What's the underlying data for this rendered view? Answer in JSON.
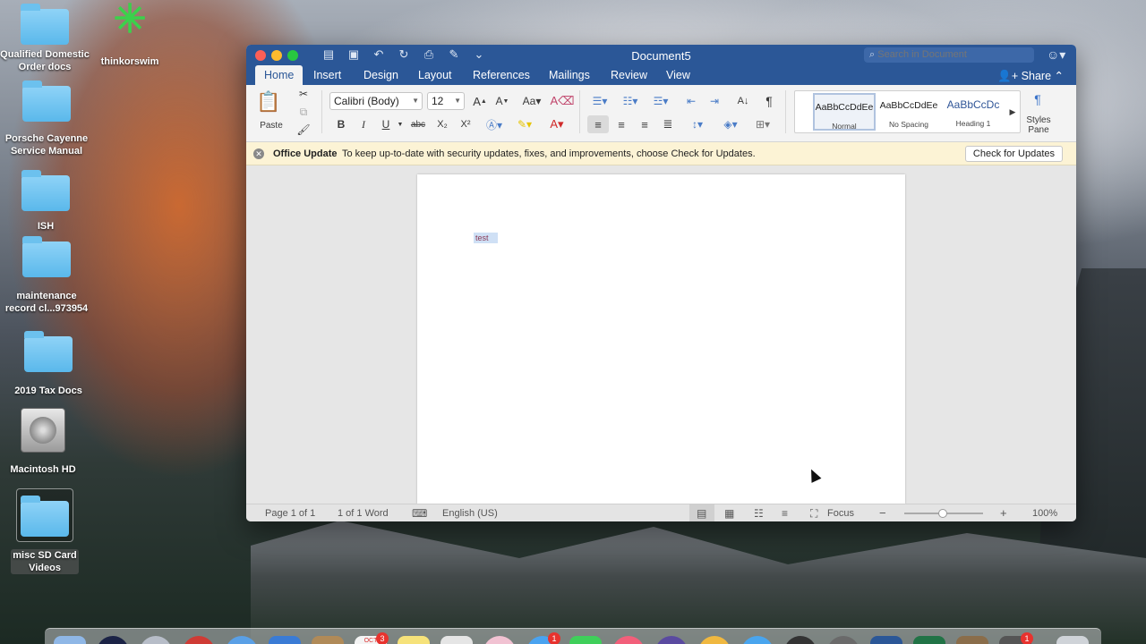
{
  "desktop": {
    "icons": [
      {
        "label": "Qualified Domestic\nOrder docs"
      },
      {
        "label": "thinkorswim"
      },
      {
        "label": "Porsche Cayenne\nService Manual"
      },
      {
        "label": "ISH"
      },
      {
        "label": "maintenance\nrecord cl...973954"
      },
      {
        "label": "2019 Tax Docs"
      },
      {
        "label": "Macintosh HD"
      },
      {
        "label": "misc SD Card\nVideos"
      }
    ]
  },
  "window": {
    "title": "Document5",
    "search_placeholder": "Search in Document",
    "tabs": [
      "Home",
      "Insert",
      "Design",
      "Layout",
      "References",
      "Mailings",
      "Review",
      "View"
    ],
    "active_tab": "Home",
    "share_label": "Share"
  },
  "ribbon": {
    "paste_label": "Paste",
    "font_name": "Calibri (Body)",
    "font_size": "12",
    "bold": "B",
    "italic": "I",
    "underline": "U",
    "strike": "abc",
    "subscript": "X₂",
    "superscript": "X²",
    "styles": [
      {
        "sample": "AaBbCcDdEe",
        "name": "Normal"
      },
      {
        "sample": "AaBbCcDdEe",
        "name": "No Spacing"
      },
      {
        "sample": "AaBbCcDc",
        "name": "Heading 1"
      }
    ],
    "styles_pane_label": "Styles\nPane"
  },
  "message_bar": {
    "title": "Office Update",
    "text": "To keep up-to-date with security updates, fixes, and improvements, choose Check for Updates.",
    "button": "Check for Updates"
  },
  "document": {
    "body_text": "test"
  },
  "status_bar": {
    "page": "Page 1 of 1",
    "words": "1 of 1 Word",
    "language": "English (US)",
    "focus": "Focus",
    "zoom": "100%",
    "zoom_minus": "−",
    "zoom_plus": "+"
  },
  "dock": {
    "calendar_month": "OCT",
    "calendar_day": "3",
    "badges": [
      "3",
      "1",
      "1"
    ]
  },
  "colors": {
    "word_blue": "#2b5797",
    "message_bg": "#fcf3d5",
    "folder_blue": "#5ab8eb"
  }
}
